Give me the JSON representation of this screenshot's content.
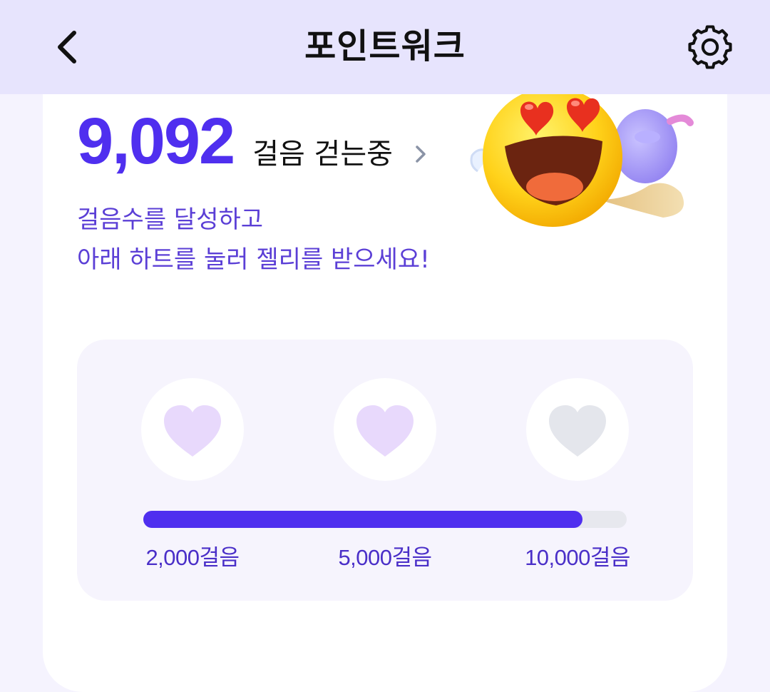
{
  "header": {
    "title": "포인트워크",
    "back_icon": "chevron-left-icon",
    "settings_icon": "gear-icon"
  },
  "steps": {
    "count": "9,092",
    "status": "걸음 걷는중",
    "chevron_icon": "chevron-right-icon"
  },
  "guide": {
    "line1": "걸음수를 달성하고",
    "line2": "아래 하트를 눌러 젤리를 받으세요!"
  },
  "illustration": {
    "icon": "heart-eyes-emoji-icon"
  },
  "milestones": {
    "progress_fraction": 0.909,
    "items": [
      {
        "label": "2,000걸음",
        "state": "active",
        "icon": "heart-icon"
      },
      {
        "label": "5,000걸음",
        "state": "active",
        "icon": "heart-icon"
      },
      {
        "label": "10,000걸음",
        "state": "inactive",
        "icon": "heart-icon"
      }
    ]
  },
  "colors": {
    "accent": "#4f2fef",
    "header_bg": "#e7e4fd",
    "heart_active": "#e8d9fc",
    "heart_inactive": "#e4e6ec",
    "guide_text": "#5b3fd6"
  }
}
